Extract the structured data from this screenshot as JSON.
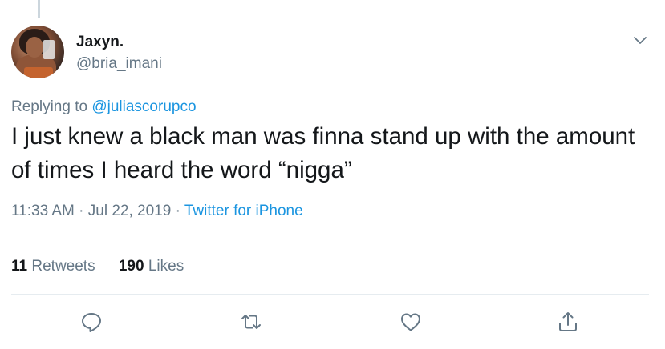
{
  "author": {
    "display_name": "Jaxyn.",
    "handle": "@bria_imani"
  },
  "reply": {
    "prefix": "Replying to ",
    "to": "@juliascorupco"
  },
  "tweet": {
    "text": "I just knew a black man was finna stand up with the amount of times I heard the word “nigga”"
  },
  "meta": {
    "time": "11:33 AM",
    "separator1": " · ",
    "date": "Jul 22, 2019",
    "separator2": " · ",
    "source": "Twitter for iPhone"
  },
  "stats": {
    "retweets_count": "11",
    "retweets_label": "Retweets",
    "likes_count": "190",
    "likes_label": "Likes"
  },
  "icons": {
    "menu": "chevron-down-icon",
    "reply": "reply-icon",
    "retweet": "retweet-icon",
    "like": "heart-icon",
    "share": "share-icon"
  },
  "colors": {
    "link": "#1b95e0",
    "secondary_text": "#657786",
    "icon": "#657786",
    "divider": "#e6ecf0"
  }
}
